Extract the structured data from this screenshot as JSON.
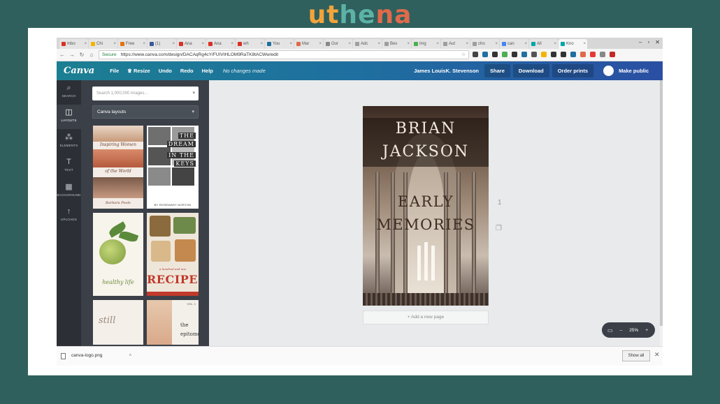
{
  "watermark": {
    "letters": [
      "u",
      "t",
      "h",
      "e",
      "n",
      "a"
    ],
    "colors": [
      "#f2a43a",
      "#f2a43a",
      "#5cb3a5",
      "#5cb3a5",
      "#e06a4b",
      "#e06a4b"
    ]
  },
  "browser": {
    "tabs": [
      {
        "label": "Inbo",
        "color": "#d93025"
      },
      {
        "label": "Chi",
        "color": "#f4b400"
      },
      {
        "label": "Free",
        "color": "#e8710a"
      },
      {
        "label": "(1)",
        "color": "#3b5998"
      },
      {
        "label": "Ana",
        "color": "#d93025"
      },
      {
        "label": "Ana",
        "color": "#d93025"
      },
      {
        "label": "wh",
        "color": "#d93025"
      },
      {
        "label": "You",
        "color": "#1f6fa0"
      },
      {
        "label": "Mar",
        "color": "#e06a4b"
      },
      {
        "label": "Our",
        "color": "#888888"
      },
      {
        "label": "Adc",
        "color": "#9e9e9e"
      },
      {
        "label": "Bes",
        "color": "#9e9e9e"
      },
      {
        "label": "img",
        "color": "#4caf50"
      },
      {
        "label": "Aut",
        "color": "#9e9e9e"
      },
      {
        "label": "cho",
        "color": "#9e9e9e"
      },
      {
        "label": "can",
        "color": "#4285f4"
      },
      {
        "label": "All",
        "color": "#00a6a6"
      },
      {
        "label": "Kno",
        "color": "#00a6a6"
      }
    ],
    "secure_label": "Secure",
    "url": "https://www.canva.com/design/DACAqRg4cY/FUIVtHLOM9RaTK8tACWw/edit",
    "ext_colors": [
      "#444",
      "#1f6fa0",
      "#333",
      "#4caf50",
      "#333",
      "#1f6fa0",
      "#555",
      "#f4b400",
      "#333",
      "#333",
      "#1f6fa0",
      "#e06a4b",
      "#e53935",
      "#888",
      "#c62828"
    ]
  },
  "canva": {
    "logo": "Canva",
    "menu": [
      "File",
      "Resize",
      "Undo",
      "Redo",
      "Help"
    ],
    "status": "No changes made",
    "user_name": "James LouisK. Stevenson",
    "share": "Share",
    "download": "Download",
    "order": "Order prints",
    "make_public": "Make public"
  },
  "rail": [
    {
      "label": "SEARCH",
      "icon": "⌕"
    },
    {
      "label": "LAYOUTS",
      "icon": "◫"
    },
    {
      "label": "ELEMENTS",
      "icon": "⁂"
    },
    {
      "label": "TEXT",
      "icon": "T"
    },
    {
      "label": "BACKGROUND",
      "icon": "▦"
    },
    {
      "label": "UPLOADS",
      "icon": "↑"
    }
  ],
  "panel": {
    "search_placeholder": "Search 1,000,000 images...",
    "layout_select": "Canva layouts",
    "t1": {
      "line1": "Inspiring Women",
      "line2": "of the World",
      "author": "Barbara Poole"
    },
    "t2": {
      "w1": "THE",
      "w2": "DREAM",
      "w3": "IN THE",
      "w4": "KEYS",
      "author": "BY ROSEMARY NORTON"
    },
    "t3": {
      "title": "healthy life"
    },
    "t4": {
      "sub": "a hundred and one",
      "title": "RECIPES"
    },
    "t5": {
      "title": "still"
    },
    "t6": {
      "vol": "VOL. 1",
      "line1": "the",
      "line2": "epitome"
    }
  },
  "canvas": {
    "author_line1": "BRIAN",
    "author_line2": "JACKSON",
    "subtitle_line1": "EARLY",
    "subtitle_line2": "MEMORIES",
    "page_number": "1",
    "add_page": "+ Add a new page",
    "zoom": "25%"
  },
  "downloads": {
    "file": "canva-logo.png",
    "show_all": "Show all"
  }
}
